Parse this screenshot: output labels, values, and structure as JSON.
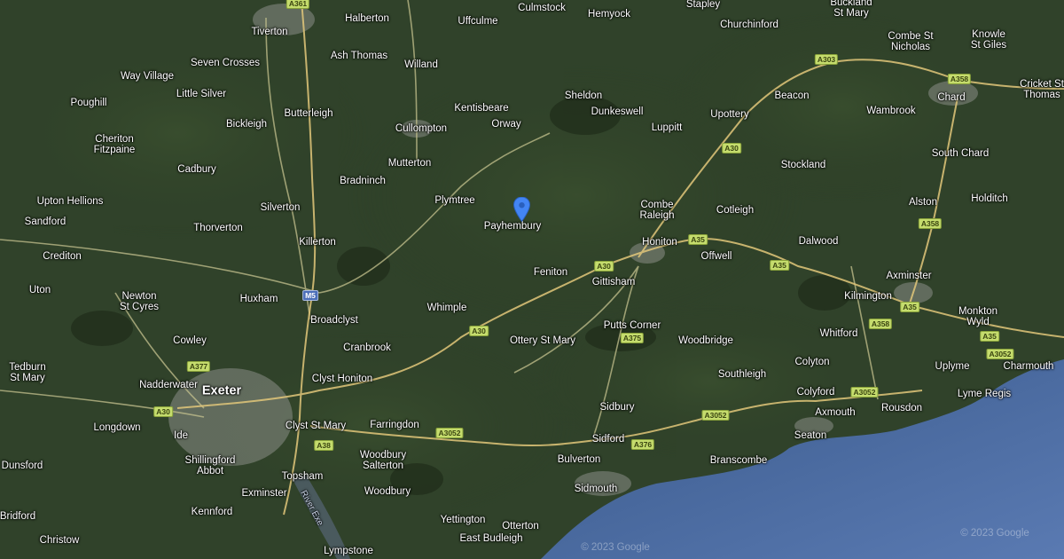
{
  "map": {
    "colors": {
      "land": "#2c3d24",
      "sea": "#3b5d94",
      "road": "#c4c18e",
      "road_major": "#e2c77a",
      "town": "#8a8e86",
      "pin": "#4385f4"
    },
    "pin_icon": "location-pin-icon",
    "copyright": [
      "© 2023 Google",
      "© 2023 Google"
    ],
    "places": [
      {
        "n": "Halberton"
      },
      {
        "n": "Uffculme"
      },
      {
        "n": "Culmstock"
      },
      {
        "n": "Hemyock"
      },
      {
        "n": "Stapley"
      },
      {
        "n": "Churchinford"
      },
      {
        "n": "Buckland\nSt Mary"
      },
      {
        "n": "Tiverton"
      },
      {
        "n": "Seven Crosses"
      },
      {
        "n": "Ash Thomas"
      },
      {
        "n": "Willand"
      },
      {
        "n": "Way Village"
      },
      {
        "n": "Little Silver"
      },
      {
        "n": "Poughill"
      },
      {
        "n": "Butterleigh"
      },
      {
        "n": "Bickleigh"
      },
      {
        "n": "Kentisbeare"
      },
      {
        "n": "Sheldon"
      },
      {
        "n": "Orway"
      },
      {
        "n": "Dunkeswell"
      },
      {
        "n": "Cullompton"
      },
      {
        "n": "Luppitt"
      },
      {
        "n": "Upottery"
      },
      {
        "n": "Beacon"
      },
      {
        "n": "Combe St\nNicholas"
      },
      {
        "n": "Knowle\nSt Giles"
      },
      {
        "n": "Cricket St\nThomas"
      },
      {
        "n": "Chard"
      },
      {
        "n": "Wambrook"
      },
      {
        "n": "Cheriton\nFitzpaine"
      },
      {
        "n": "Cadbury"
      },
      {
        "n": "Mutterton"
      },
      {
        "n": "Stockland"
      },
      {
        "n": "South Chard"
      },
      {
        "n": "Bradninch"
      },
      {
        "n": "Plymtree"
      },
      {
        "n": "Payhembury"
      },
      {
        "n": "Combe\nRaleigh"
      },
      {
        "n": "Cotleigh"
      },
      {
        "n": "Upton Hellions"
      },
      {
        "n": "Holditch"
      },
      {
        "n": "Alston"
      },
      {
        "n": "Sandford"
      },
      {
        "n": "Thorverton"
      },
      {
        "n": "Silverton"
      },
      {
        "n": "Killerton"
      },
      {
        "n": "Honiton"
      },
      {
        "n": "Dalwood"
      },
      {
        "n": "Crediton"
      },
      {
        "n": "Offwell"
      },
      {
        "n": "Feniton"
      },
      {
        "n": "Gittisham"
      },
      {
        "n": "Axminster"
      },
      {
        "n": "Uton"
      },
      {
        "n": "Newton\nSt Cyres"
      },
      {
        "n": "Huxham"
      },
      {
        "n": "Whimple"
      },
      {
        "n": "Kilmington"
      },
      {
        "n": "Monkton\nWyld"
      },
      {
        "n": "Broadclyst"
      },
      {
        "n": "Putts Corner"
      },
      {
        "n": "Cowley"
      },
      {
        "n": "Cranbrook"
      },
      {
        "n": "Ottery St Mary"
      },
      {
        "n": "Woodbridge"
      },
      {
        "n": "Whitford"
      },
      {
        "n": "Colyton"
      },
      {
        "n": "Uplyme"
      },
      {
        "n": "Charmouth"
      },
      {
        "n": "Tedburn\nSt Mary"
      },
      {
        "n": "Southleigh"
      },
      {
        "n": "Nadderwater"
      },
      {
        "n": "Exeter",
        "city": true
      },
      {
        "n": "Clyst Honiton"
      },
      {
        "n": "Colyford"
      },
      {
        "n": "Lyme Regis"
      },
      {
        "n": "Axmouth"
      },
      {
        "n": "Rousdon"
      },
      {
        "n": "Sidbury"
      },
      {
        "n": "Longdown"
      },
      {
        "n": "Farringdon"
      },
      {
        "n": "Clyst St Mary"
      },
      {
        "n": "Ide"
      },
      {
        "n": "Seaton"
      },
      {
        "n": "Sidford"
      },
      {
        "n": "Woodbury\nSalterton"
      },
      {
        "n": "Dunsford"
      },
      {
        "n": "Shillingford\nAbbot"
      },
      {
        "n": "Bulverton"
      },
      {
        "n": "Branscombe"
      },
      {
        "n": "Topsham"
      },
      {
        "n": "Exminster"
      },
      {
        "n": "Woodbury"
      },
      {
        "n": "Sidmouth"
      },
      {
        "n": "Kennford"
      },
      {
        "n": "River Exe",
        "water": true
      },
      {
        "n": "Bridford"
      },
      {
        "n": "Yettington"
      },
      {
        "n": "Otterton"
      },
      {
        "n": "Christow"
      },
      {
        "n": "East Budleigh"
      },
      {
        "n": "Lympstone"
      }
    ],
    "road_shields": [
      {
        "t": "A361"
      },
      {
        "t": "A303"
      },
      {
        "t": "A358"
      },
      {
        "t": "A30"
      },
      {
        "t": "A35"
      },
      {
        "t": "A358"
      },
      {
        "t": "A30"
      },
      {
        "t": "A35"
      },
      {
        "t": "M5",
        "m": true
      },
      {
        "t": "A35"
      },
      {
        "t": "A358"
      },
      {
        "t": "A30"
      },
      {
        "t": "A375"
      },
      {
        "t": "A35"
      },
      {
        "t": "A377"
      },
      {
        "t": "A3052"
      },
      {
        "t": "A30"
      },
      {
        "t": "A3052"
      },
      {
        "t": "A3052"
      },
      {
        "t": "A3052"
      },
      {
        "t": "A376"
      },
      {
        "t": "A38"
      }
    ]
  }
}
